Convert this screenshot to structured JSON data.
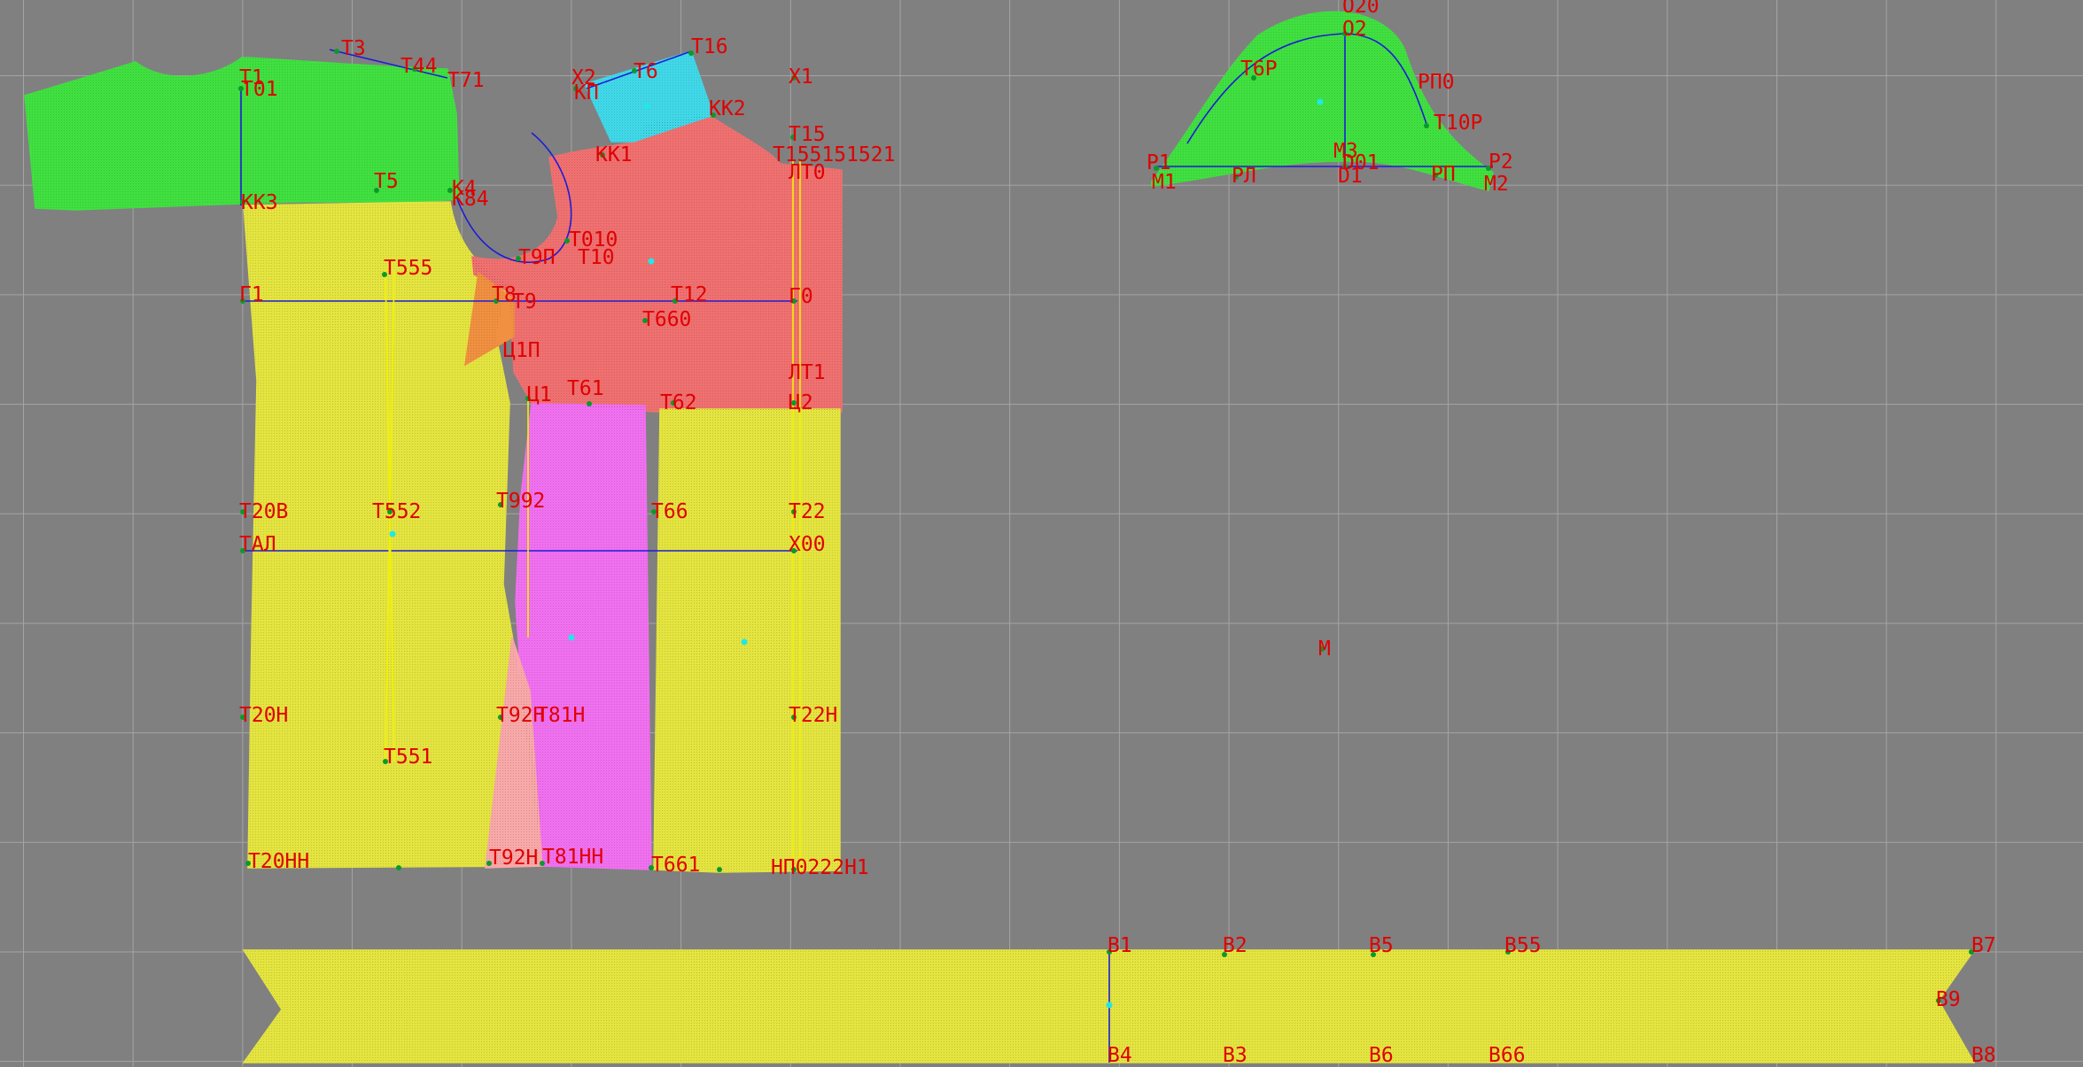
{
  "canvas": {
    "background": "#808080",
    "grid_color": "#a4a4a4"
  },
  "colors": {
    "sleeve_green": "#40e040",
    "back_yellow": "#e4e440",
    "front_salmon": "#f07070",
    "yoke_cyan": "#40d8e8",
    "magenta_panel": "#f070f0",
    "orange_wedge": "#f09040",
    "pink_gusset": "#f8a8a8",
    "label_red": "#e00000",
    "construction_blue": "#1c1cd8",
    "node_green": "#0a9a2a",
    "center_cyan": "#20e8e8"
  },
  "pieces": [
    {
      "name": "sleeve-cap-piece",
      "color": "sleeve_green"
    },
    {
      "name": "back-panel-piece",
      "color": "back_yellow"
    },
    {
      "name": "front-upper-piece",
      "color": "front_salmon"
    },
    {
      "name": "shoulder-yoke-piece",
      "color": "yoke_cyan"
    },
    {
      "name": "side-panel-piece",
      "color": "magenta_panel"
    },
    {
      "name": "front-lower-piece",
      "color": "back_yellow"
    },
    {
      "name": "armhole-wedge-piece",
      "color": "orange_wedge"
    },
    {
      "name": "side-gusset-piece",
      "color": "pink_gusset"
    },
    {
      "name": "collar-piece",
      "color": "sleeve_green"
    },
    {
      "name": "waistband-piece",
      "color": "back_yellow"
    }
  ],
  "labels": [
    {
      "text": "T1"
    },
    {
      "text": "T01"
    },
    {
      "text": "T3"
    },
    {
      "text": "T44"
    },
    {
      "text": "T71"
    },
    {
      "text": "X2"
    },
    {
      "text": "T6"
    },
    {
      "text": "T16"
    },
    {
      "text": "X1"
    },
    {
      "text": "KП"
    },
    {
      "text": "KK2"
    },
    {
      "text": "KK1"
    },
    {
      "text": "T15"
    },
    {
      "text": "T155151521"
    },
    {
      "text": "ЛT0"
    },
    {
      "text": "T5"
    },
    {
      "text": "K4"
    },
    {
      "text": "K84"
    },
    {
      "text": "KK3"
    },
    {
      "text": "T010"
    },
    {
      "text": "T9П"
    },
    {
      "text": "T10"
    },
    {
      "text": "T555"
    },
    {
      "text": "Г1"
    },
    {
      "text": "T8"
    },
    {
      "text": "T9"
    },
    {
      "text": "T12"
    },
    {
      "text": "Г0"
    },
    {
      "text": "T660"
    },
    {
      "text": "Ц1П"
    },
    {
      "text": "ЛT1"
    },
    {
      "text": "Ц1"
    },
    {
      "text": "T61"
    },
    {
      "text": "T62"
    },
    {
      "text": "Ц2"
    },
    {
      "text": "T20B"
    },
    {
      "text": "T552"
    },
    {
      "text": "T992"
    },
    {
      "text": "T66"
    },
    {
      "text": "T22"
    },
    {
      "text": "TAЛ"
    },
    {
      "text": "X00"
    },
    {
      "text": "T20H"
    },
    {
      "text": "T92H"
    },
    {
      "text": "T81H"
    },
    {
      "text": "T22H"
    },
    {
      "text": "T551"
    },
    {
      "text": "T20HH"
    },
    {
      "text": "T92H"
    },
    {
      "text": "T81HH"
    },
    {
      "text": "T661"
    },
    {
      "text": "HП0222H1"
    },
    {
      "text": "O20"
    },
    {
      "text": "O2"
    },
    {
      "text": "T6P"
    },
    {
      "text": "PП0"
    },
    {
      "text": "T10P"
    },
    {
      "text": "P1"
    },
    {
      "text": "P2"
    },
    {
      "text": "M1"
    },
    {
      "text": "PЛ"
    },
    {
      "text": "M3"
    },
    {
      "text": "D1"
    },
    {
      "text": "D01"
    },
    {
      "text": "PП"
    },
    {
      "text": "M2"
    },
    {
      "text": "M"
    },
    {
      "text": "B1"
    },
    {
      "text": "B2"
    },
    {
      "text": "B5"
    },
    {
      "text": "B55"
    },
    {
      "text": "B7"
    },
    {
      "text": "B9"
    },
    {
      "text": "B8"
    },
    {
      "text": "B4"
    },
    {
      "text": "B3"
    },
    {
      "text": "B6"
    },
    {
      "text": "B66"
    }
  ]
}
